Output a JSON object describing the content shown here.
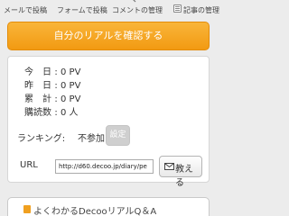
{
  "nav": {
    "mail_post": "メールで投稿",
    "form_post": "フォームで投稿",
    "comment_manage": "コメントの管理",
    "article_manage": "記事の管理"
  },
  "cta": {
    "label": "自分のリアルを確認する"
  },
  "stats": [
    {
      "label": "今日",
      "value": "0 PV"
    },
    {
      "label": "昨日",
      "value": "0 PV"
    },
    {
      "label": "累計",
      "value": "0 PV"
    },
    {
      "label": "購読数",
      "value": "0 人"
    }
  ],
  "ranking": {
    "label": "ランキング:",
    "value": "不参加",
    "settings_label": "設定"
  },
  "url": {
    "label": "URL",
    "value": "http://d60.decoo.jp/diary/pe"
  },
  "teach_button": "教える",
  "faq": {
    "label": "よくわかるDecooリアルQ＆A"
  },
  "colors": {
    "accent": "#f29a12",
    "disabled": "#cfcfcf"
  },
  "icons": [
    "mail-icon",
    "form-icon",
    "comment-icon",
    "article-icon",
    "book-icon"
  ]
}
